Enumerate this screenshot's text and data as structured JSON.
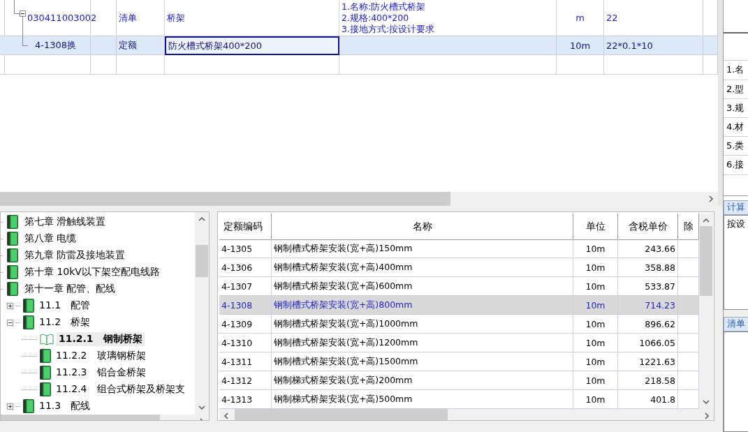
{
  "bill_grid": {
    "rows": [
      {
        "kind": "bill",
        "code": "030411003002",
        "expanded": true,
        "type": "清单",
        "name": "桥架",
        "features": [
          "1.名称:防火槽式桥架",
          "2.规格:400*200",
          "3.接地方式:按设计要求"
        ],
        "unit": "m",
        "quantity": "22",
        "selected": false
      },
      {
        "kind": "quota",
        "code": "4-1308换",
        "type": "定额",
        "name": "防火槽式桥架400*200",
        "features": [],
        "unit": "10m",
        "quantity": "22*0.1*10",
        "selected": true
      }
    ]
  },
  "side_panel": {
    "features": [
      "1.名",
      "2.型",
      "3.规",
      "4.材",
      "5.类",
      "6.接"
    ],
    "calc_header": "计算",
    "calc_text": "按设",
    "bill_header": "清单"
  },
  "tree": [
    {
      "label": "第七章 滑触线装置",
      "selected": false
    },
    {
      "label": "第八章 电缆",
      "selected": false
    },
    {
      "label": "第九章 防雷及接地装置",
      "selected": false
    },
    {
      "label": "第十章 10kV以下架空配电线路",
      "selected": false
    },
    {
      "label": "第十一章 配管、配线",
      "selected": false,
      "children": [
        {
          "number": "11.1",
          "label": "配管",
          "expanded": false,
          "selected": false
        },
        {
          "number": "11.2",
          "label": "桥架",
          "expanded": true,
          "selected": false,
          "children": [
            {
              "number": "11.2.1",
              "label": "钢制桥架",
              "selected": true
            },
            {
              "number": "11.2.2",
              "label": "玻璃钢桥架",
              "selected": false
            },
            {
              "number": "11.2.3",
              "label": "铝合金桥架",
              "selected": false
            },
            {
              "number": "11.2.4",
              "label": "组合式桥架及桥架支",
              "selected": false
            }
          ]
        },
        {
          "number": "11.3",
          "label": "配线",
          "expanded": false,
          "selected": false
        }
      ]
    }
  ],
  "quota_table": {
    "columns": [
      "定额编码",
      "名称",
      "单位",
      "含税单价",
      "除"
    ],
    "rows": [
      {
        "code": "4-1305",
        "name": "钢制槽式桥架安装(宽+高)150mm",
        "unit": "10m",
        "price": "243.66",
        "selected": false
      },
      {
        "code": "4-1306",
        "name": "钢制槽式桥架安装(宽+高)400mm",
        "unit": "10m",
        "price": "358.88",
        "selected": false
      },
      {
        "code": "4-1307",
        "name": "钢制槽式桥架安装(宽+高)600mm",
        "unit": "10m",
        "price": "533.87",
        "selected": false
      },
      {
        "code": "4-1308",
        "name": "钢制槽式桥架安装(宽+高)800mm",
        "unit": "10m",
        "price": "714.23",
        "selected": true
      },
      {
        "code": "4-1309",
        "name": "钢制槽式桥架安装(宽+高)1000mm",
        "unit": "10m",
        "price": "896.62",
        "selected": false
      },
      {
        "code": "4-1310",
        "name": "钢制槽式桥架安装(宽+高)1200mm",
        "unit": "10m",
        "price": "1066.05",
        "selected": false
      },
      {
        "code": "4-1311",
        "name": "钢制槽式桥架安装(宽+高)1500mm",
        "unit": "10m",
        "price": "1221.63",
        "selected": false
      },
      {
        "code": "4-1312",
        "name": "钢制梯式桥架安装(宽+高)200mm",
        "unit": "10m",
        "price": "218.58",
        "selected": false
      },
      {
        "code": "4-1313",
        "name": "钢制梯式桥架安装(宽+高)500mm",
        "unit": "10m",
        "price": "401.8",
        "selected": false
      }
    ]
  }
}
